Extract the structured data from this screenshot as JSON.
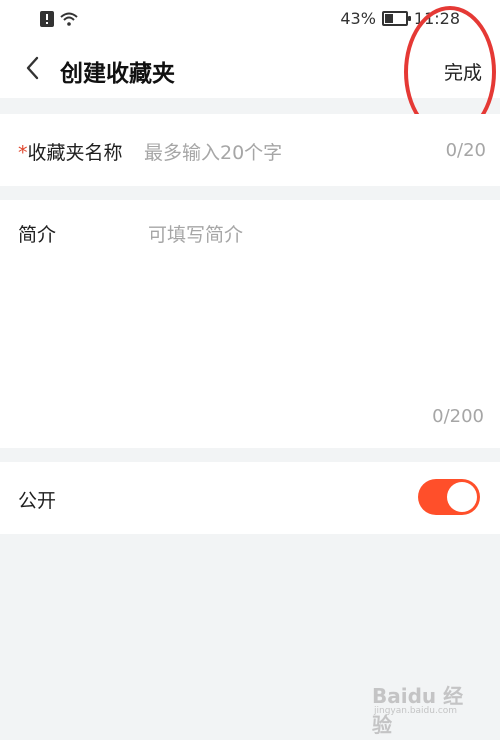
{
  "statusbar": {
    "battery_percent": "43%",
    "battery_level": 0.43,
    "time": "11:28"
  },
  "navbar": {
    "title": "创建收藏夹",
    "done_label": "完成"
  },
  "form": {
    "name": {
      "required_mark": "*",
      "label": "收藏夹名称",
      "placeholder": "最多输入20个字",
      "counter": "0/20"
    },
    "intro": {
      "label": "简介",
      "placeholder": "可填写简介",
      "counter": "0/200"
    },
    "public": {
      "label": "公开",
      "enabled": true
    }
  },
  "colors": {
    "accent": "#ff4f2a",
    "annotation": "#e53935",
    "background": "#f2f4f5"
  },
  "watermark": {
    "logo": "Baidu 经验",
    "url": "jingyan.baidu.com"
  }
}
